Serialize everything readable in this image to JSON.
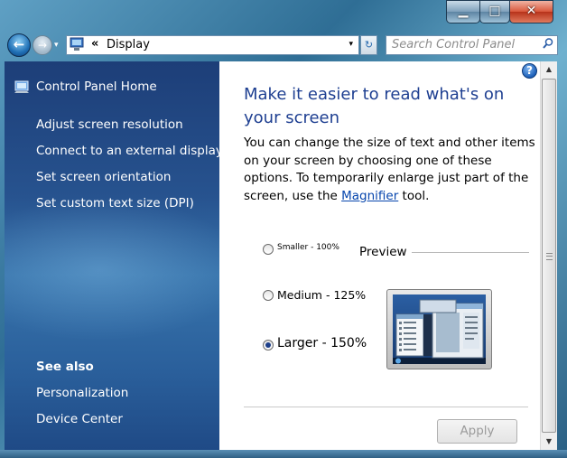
{
  "window": {
    "minimize_glyph": "▁",
    "maximize_glyph": "□",
    "close_glyph": "✕"
  },
  "addressbar": {
    "back_glyph": "←",
    "forward_glyph": "→",
    "separator": "«",
    "location": "Display",
    "dropdown_glyph": "▾",
    "refresh_glyph": "↻",
    "search_placeholder": "Search Control Panel"
  },
  "sidebar": {
    "home": "Control Panel Home",
    "tasks": [
      "Adjust screen resolution",
      "Connect to an external display",
      "Set screen orientation",
      "Set custom text size (DPI)"
    ],
    "see_also": {
      "header": "See also",
      "links": [
        "Personalization",
        "Device Center"
      ]
    }
  },
  "main": {
    "help_glyph": "?",
    "title": "Make it easier to read what's on your screen",
    "description_prefix": "You can change the size of text and other items on your screen by choosing one of these options. To temporarily enlarge just part of the screen, use the ",
    "magnifier_link": "Magnifier",
    "description_suffix": " tool.",
    "options": [
      {
        "label": "Smaller - 100%",
        "selected": false
      },
      {
        "label": "Medium - 125%",
        "selected": false
      },
      {
        "label": "Larger - 150%",
        "selected": true
      }
    ],
    "preview_label": "Preview",
    "apply_label": "Apply"
  },
  "colors": {
    "title_blue": "#1e3f91",
    "link_blue": "#0645ad",
    "sidebar_dark": "#1d3e78"
  },
  "icons": {
    "address": "control-panel-icon",
    "home": "control-panel-home-icon",
    "search": "search-icon",
    "help": "help-icon"
  }
}
